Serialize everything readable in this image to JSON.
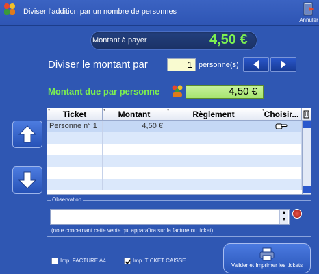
{
  "window": {
    "title": "Diviser l'addition par un nombre de personnes",
    "cancel_label": "Annuler"
  },
  "payment": {
    "label": "Montant à payer",
    "amount": "4,50 €"
  },
  "split": {
    "label": "Diviser le montant par",
    "count": "1",
    "unit": "personne(s)"
  },
  "due": {
    "label": "Montant due par personne",
    "amount": "4,50 €"
  },
  "grid": {
    "columns": [
      "Ticket",
      "Montant",
      "Règlement",
      "Choisir..."
    ],
    "rows": [
      {
        "ticket": "Personne n° 1",
        "montant": "4,50 €",
        "reglement": "",
        "choisir_icon": "pointing-hand-icon"
      }
    ],
    "empty_rows": 5
  },
  "observation": {
    "title": "Observation",
    "value": "",
    "note": "(note concernant cette vente qui apparaîtra sur la facture ou ticket)"
  },
  "options": {
    "facture_label": "Imp. FACTURE A4",
    "facture_checked": false,
    "ticket_label": "Imp. TICKET CAISSE",
    "ticket_checked": true
  },
  "validate": {
    "label": "Valider et Imprimer les tickets"
  },
  "colors": {
    "background": "#2f57b3",
    "accent_green": "#7cf050",
    "row_selected": "#c5d8f5",
    "row_alt": "#dbe8fb"
  }
}
